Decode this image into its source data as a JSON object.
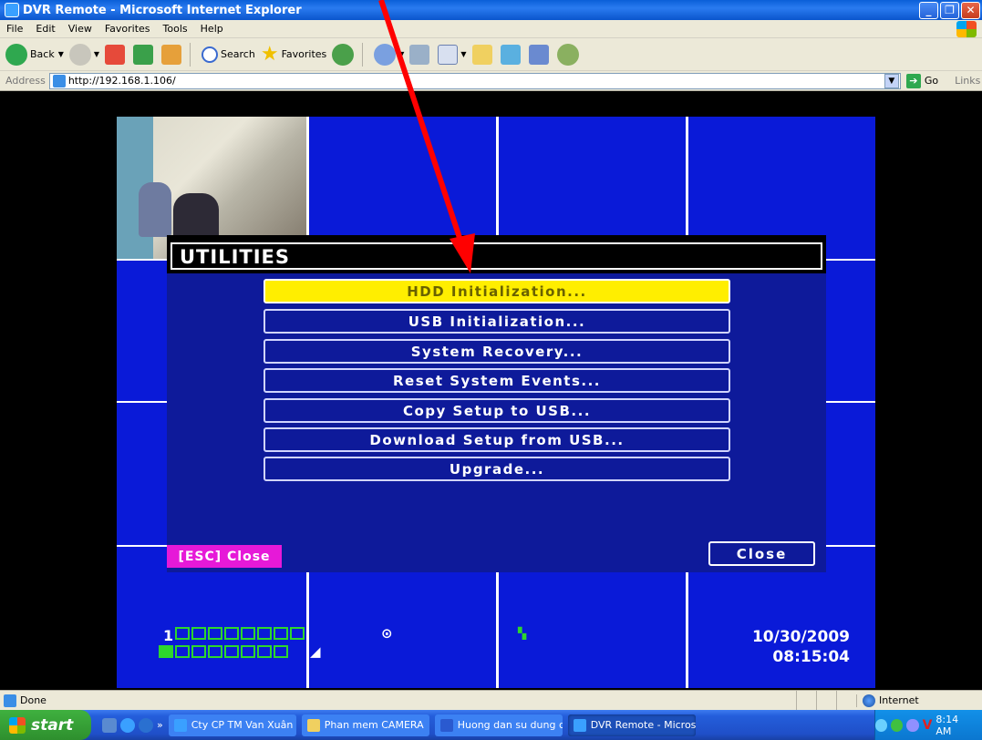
{
  "window": {
    "title": "DVR Remote - Microsoft Internet Explorer"
  },
  "menubar": [
    "File",
    "Edit",
    "View",
    "Favorites",
    "Tools",
    "Help"
  ],
  "toolbar": {
    "back": "Back",
    "search": "Search",
    "favorites": "Favorites"
  },
  "address": {
    "label": "Address",
    "url": "http://192.168.1.106/",
    "go": "Go",
    "links": "Links"
  },
  "dvr": {
    "dialog_title": "UTILITIES",
    "items": [
      "HDD Initialization...",
      "USB Initialization...",
      "System Recovery...",
      "Reset System Events...",
      "Copy Setup to USB...",
      "Download Setup from USB...",
      "Upgrade..."
    ],
    "selected_index": 0,
    "esc_label": "[ESC] Close",
    "close_label": "Close",
    "channel_number": "1",
    "date": "10/30/2009",
    "time": "08:15:04"
  },
  "statusbar": {
    "status": "Done",
    "zone": "Internet"
  },
  "taskbar": {
    "start": "start",
    "tasks": [
      "Cty CP TM Van Xuân ...",
      "Phan mem CAMERA",
      "Huong dan su dung d...",
      "DVR Remote - Micros..."
    ],
    "clock": "8:14 AM"
  },
  "colors": {
    "dvr_background": "#0a1ad8",
    "selected_item": "#ffee00",
    "esc_badge": "#e619d8",
    "arrow": "#ff0000"
  }
}
